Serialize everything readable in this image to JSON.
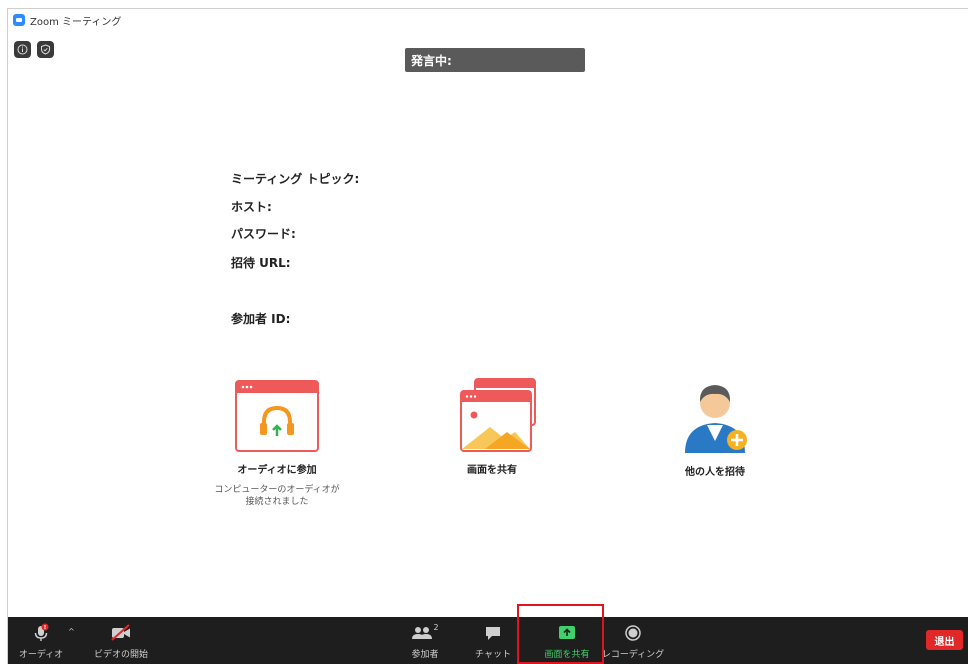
{
  "window": {
    "title": "Zoom ミーティング"
  },
  "top_icons": [
    "info-icon",
    "shield-icon"
  ],
  "speaking_banner": "発言中:",
  "meeting_info": {
    "topic": "ミーティング トピック:",
    "host": "ホスト:",
    "password": "パスワード:",
    "invite_url": "招待 URL:",
    "participant_id": "参加者 ID:"
  },
  "actions": {
    "join_audio": {
      "label": "オーディオに参加",
      "sub1": "コンピューターのオーディオが",
      "sub2": "接続されました",
      "icon": "headphones-icon"
    },
    "share_screen": {
      "label": "画面を共有",
      "icon": "share-screen-icon"
    },
    "invite": {
      "label": "他の人を招待",
      "icon": "invite-person-icon"
    }
  },
  "toolbar": {
    "audio": "オーディオ",
    "video": "ビデオの開始",
    "participants": "参加者",
    "participants_count": "2",
    "chat": "チャット",
    "share": "画面を共有",
    "record": "レコーディング",
    "leave": "退出"
  },
  "colors": {
    "toolbar_bg": "#1e1e1e",
    "share_green": "#3fd16a",
    "leave_red": "#e02828",
    "highlight_red": "#e0141e",
    "icon_red": "#ee5a5a",
    "accent_orange": "#f5961f"
  }
}
